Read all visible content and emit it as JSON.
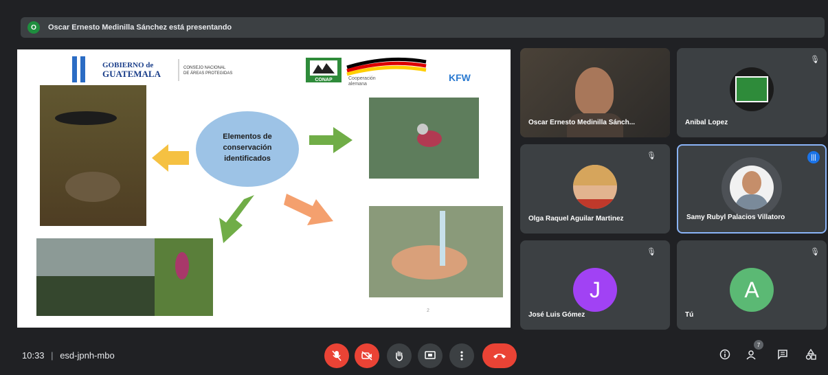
{
  "meeting": {
    "presenting_initial": "O",
    "presenting_text": "Oscar Ernesto Medinilla Sánchez está presentando",
    "time": "10:33",
    "code": "esd-jpnh-mbo",
    "people_count": "7"
  },
  "slide": {
    "logo_gov_line1": "GOBIERNO de",
    "logo_gov_line2": "GUATEMALA",
    "logo_conap_line1": "CONSEJO NACIONAL",
    "logo_conap_line2": "DE ÁREAS PROTEGIDAS",
    "logo_conap_short": "CONAP",
    "logo_coop_line1": "Cooperación",
    "logo_coop_line2": "alemana",
    "logo_kfw": "KFW",
    "center_text_1": "Elementos de",
    "center_text_2": "conservación",
    "center_text_3": "identificados",
    "page_marker": "2"
  },
  "participants": [
    {
      "name": "Oscar Ernesto Medinilla Sánch..."
    },
    {
      "name": "Anibal Lopez"
    },
    {
      "name": "Olga Raquel Aguilar Martinez"
    },
    {
      "name": "Samy Rubyl Palacios Villatoro"
    },
    {
      "name": "José Luis Gómez",
      "initial": "J"
    },
    {
      "name": "Tú",
      "initial": "A"
    }
  ],
  "colors": {
    "background": "#202124",
    "tile": "#3c4043",
    "end_call": "#ea4335",
    "active_border": "#8ab4f8",
    "avatar_j": "#a142f4",
    "avatar_a": "#5bb974"
  }
}
